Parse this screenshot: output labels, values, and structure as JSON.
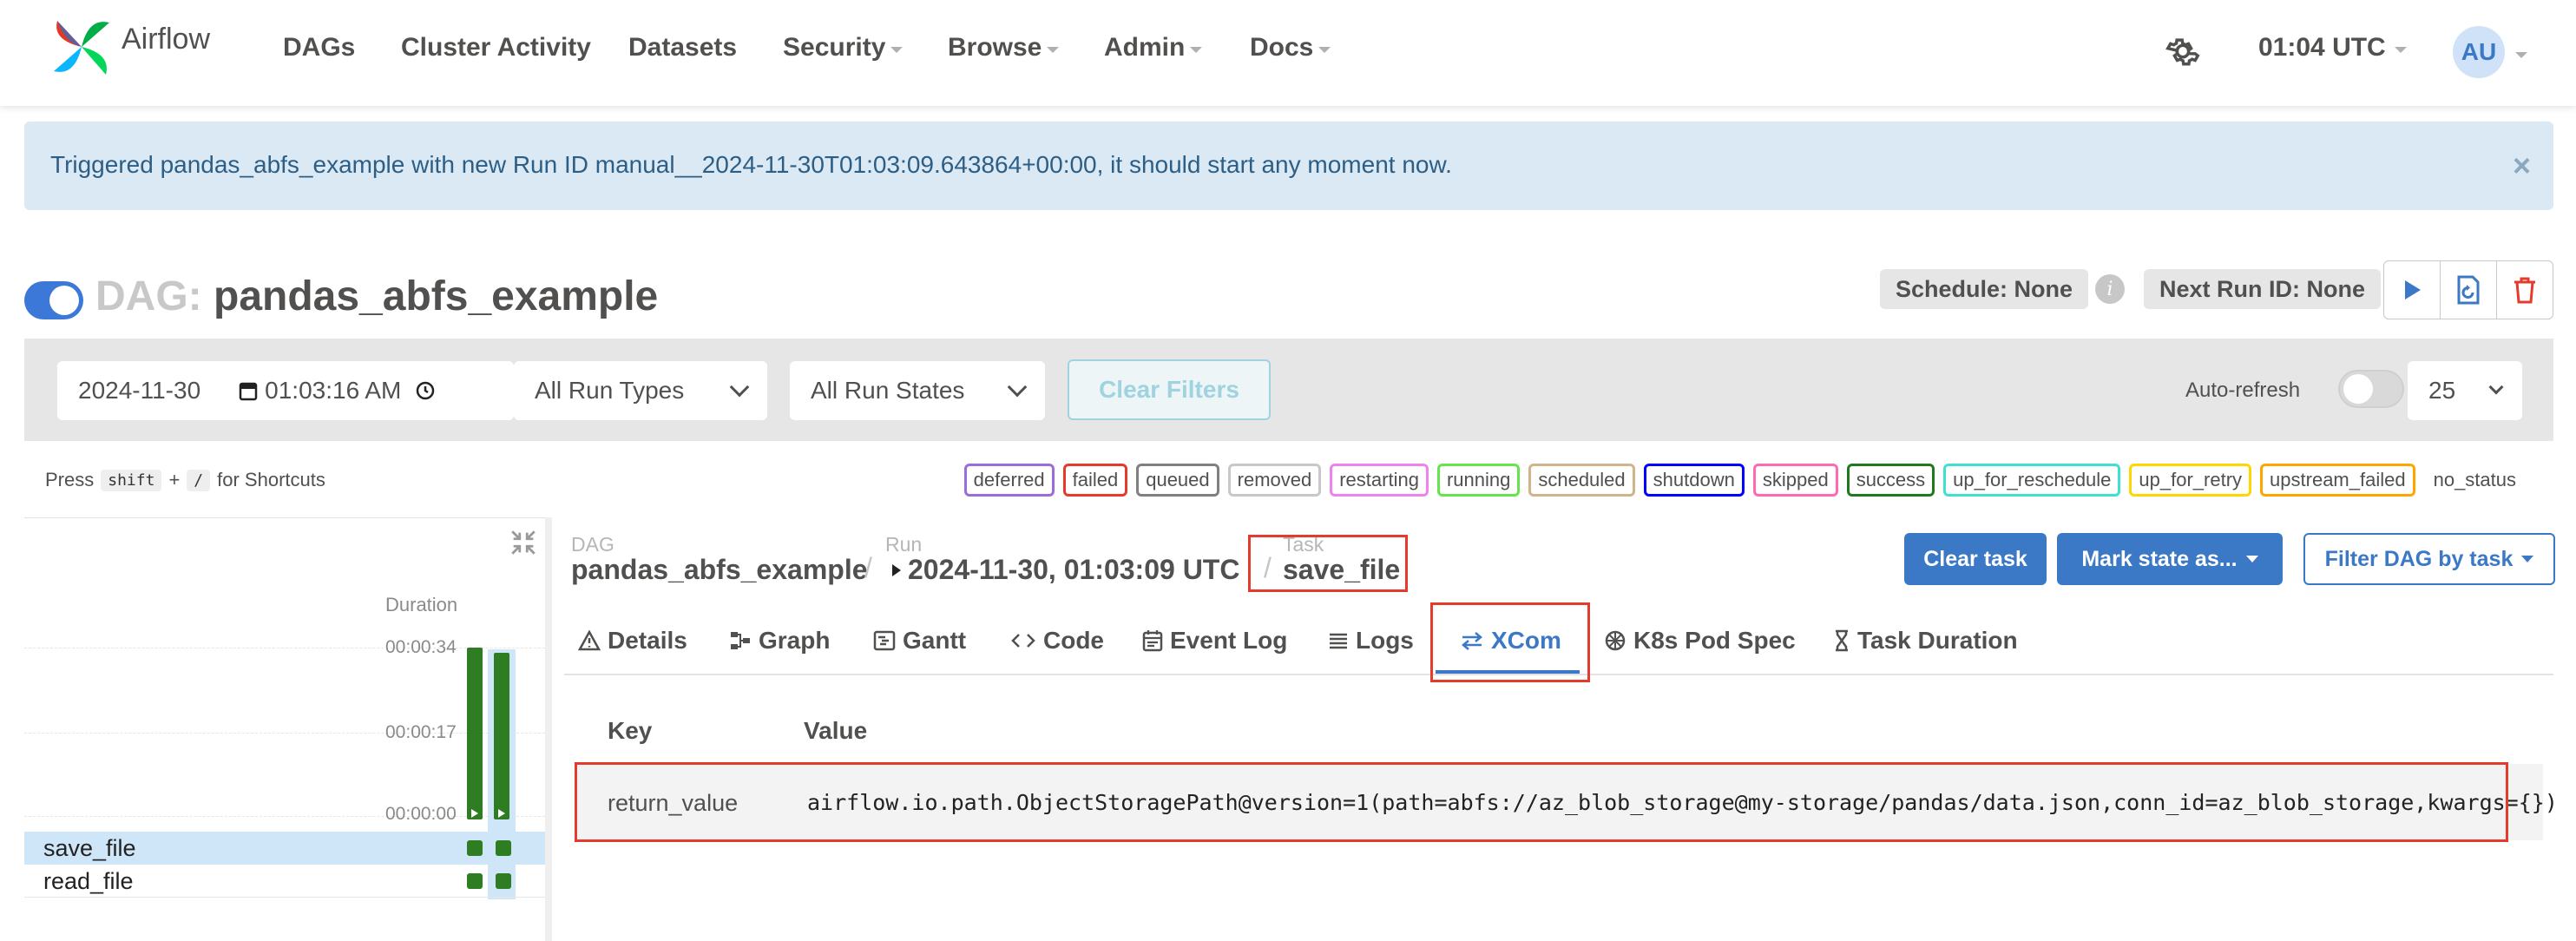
{
  "nav": {
    "brand": "Airflow",
    "items": [
      "DAGs",
      "Cluster Activity",
      "Datasets",
      "Security",
      "Browse",
      "Admin",
      "Docs"
    ],
    "time": "01:04 UTC",
    "avatar_initials": "AU",
    "settings_icon": "gear-icon"
  },
  "alert": {
    "message": "Triggered pandas_abfs_example with new Run ID manual__2024-11-30T01:03:09.643864+00:00, it should start any moment now.",
    "close": "×"
  },
  "dag": {
    "prefix": "DAG:",
    "name": "pandas_abfs_example",
    "schedule": "Schedule: None",
    "next_run": "Next Run ID: None",
    "info_glyph": "i"
  },
  "filters": {
    "date": "2024-11-30",
    "time": "01:03:16  AM",
    "run_types": "All Run Types",
    "run_states": "All Run States",
    "clear_filters": "Clear Filters",
    "auto_refresh": "Auto-refresh",
    "page_size": "25"
  },
  "shortcuts": {
    "press": "Press",
    "key1": "shift",
    "plus": "+",
    "key2": "/",
    "for": "for Shortcuts"
  },
  "legend": [
    {
      "label": "deferred",
      "color": "#9b6ddc"
    },
    {
      "label": "failed",
      "color": "#e53b2c"
    },
    {
      "label": "queued",
      "color": "#808080"
    },
    {
      "label": "removed",
      "color": "#c8c8c8"
    },
    {
      "label": "restarting",
      "color": "#ee82ee"
    },
    {
      "label": "running",
      "color": "#66e34d"
    },
    {
      "label": "scheduled",
      "color": "#d2b48c"
    },
    {
      "label": "shutdown",
      "color": "#0000ff"
    },
    {
      "label": "skipped",
      "color": "#ff69b4"
    },
    {
      "label": "success",
      "color": "#1f7a1f"
    },
    {
      "label": "up_for_reschedule",
      "color": "#40e0d0"
    },
    {
      "label": "up_for_retry",
      "color": "#ffd700"
    },
    {
      "label": "upstream_failed",
      "color": "#ffa500"
    },
    {
      "label": "no_status",
      "color": "transparent"
    }
  ],
  "grid": {
    "duration_label": "Duration",
    "ticks": [
      "00:00:34",
      "00:00:17",
      "00:00:00"
    ],
    "tasks": [
      "save_file",
      "read_file"
    ],
    "run_durations_seconds": [
      34,
      33
    ]
  },
  "breadcrumb": {
    "dag_label": "DAG",
    "dag_value": "pandas_abfs_example",
    "run_label": "Run",
    "run_value": "2024-11-30, 01:03:09 UTC",
    "task_label": "Task",
    "task_value": "save_file",
    "sep": "/"
  },
  "actions": {
    "clear_task": "Clear task",
    "mark_state": "Mark state as...",
    "filter_dag": "Filter DAG by task"
  },
  "tabs": [
    "Details",
    "Graph",
    "Gantt",
    "Code",
    "Event Log",
    "Logs",
    "XCom",
    "K8s Pod Spec",
    "Task Duration"
  ],
  "active_tab": "XCom",
  "xcom": {
    "key_header": "Key",
    "value_header": "Value",
    "rows": [
      {
        "key": "return_value",
        "value": "airflow.io.path.ObjectStoragePath@version=1(path=abfs://az_blob_storage@my-storage/pandas/data.json,conn_id=az_blob_storage,kwargs={})"
      }
    ]
  }
}
